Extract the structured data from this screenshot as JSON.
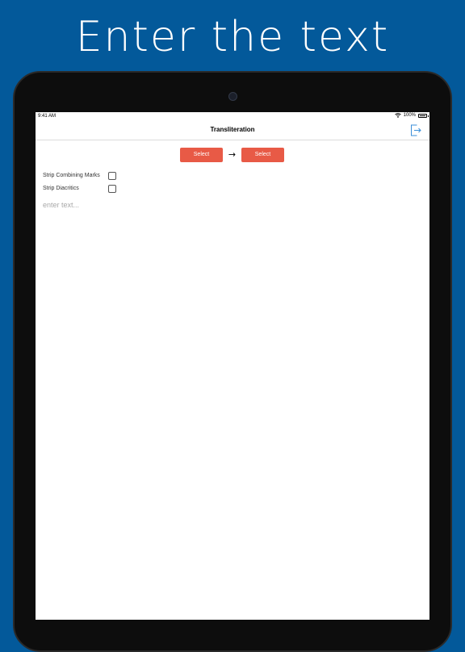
{
  "headline": "Enter the text",
  "status_bar": {
    "time": "9:41 AM",
    "battery": "100%"
  },
  "nav": {
    "title": "Transliteration",
    "export_icon": "export-icon"
  },
  "language_picker": {
    "source_label": "Select",
    "target_label": "Select",
    "arrow": "→"
  },
  "options": [
    {
      "label": "Strip Combining Marks",
      "checked": false
    },
    {
      "label": "Strip Diacritics",
      "checked": false
    }
  ],
  "input": {
    "value": "",
    "placeholder": "enter text..."
  },
  "colors": {
    "background": "#03599a",
    "button": "#e85a46",
    "accent": "#3b8fd9"
  }
}
